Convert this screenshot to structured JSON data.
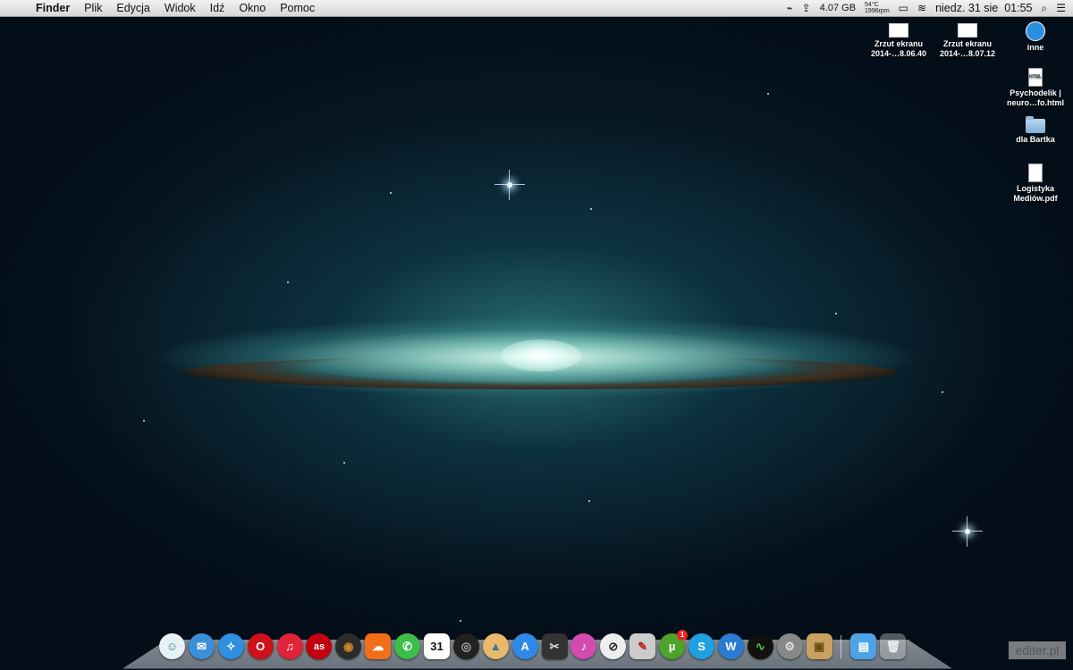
{
  "menubar": {
    "app_name": "Finder",
    "menus": [
      "Plik",
      "Edycja",
      "Widok",
      "Idź",
      "Okno",
      "Pomoc"
    ],
    "status": {
      "disk": "4.07 GB",
      "temp": "54°C",
      "fan": "1996rpm",
      "datetime": "niedz. 31 sie  01:55"
    }
  },
  "desktop": {
    "icons": [
      {
        "label_line1": "Zrzut ekranu",
        "label_line2": "2014-…8.06.40",
        "type": "screenshot"
      },
      {
        "label_line1": "Zrzut ekranu",
        "label_line2": "2014-…8.07.12",
        "type": "screenshot"
      },
      {
        "label_line1": "inne",
        "label_line2": "",
        "type": "folder-blue"
      },
      {
        "label_line1": "Psychodelik |",
        "label_line2": "neuro…fo.html",
        "type": "html-file",
        "badge": "HTML"
      },
      {
        "label_line1": "dla Bartka",
        "label_line2": "",
        "type": "folder"
      },
      {
        "label_line1": "Logistyka",
        "label_line2": "Mediów.pdf",
        "type": "pdf-file"
      }
    ]
  },
  "dock": {
    "calendar_day": "31",
    "utorrent_badge": "1"
  },
  "watermark": "editer.pl",
  "colors": {
    "space_bg": "#02080f",
    "galaxy_glow": "#96dccd",
    "menubar_bg": "#e6e6e6"
  }
}
